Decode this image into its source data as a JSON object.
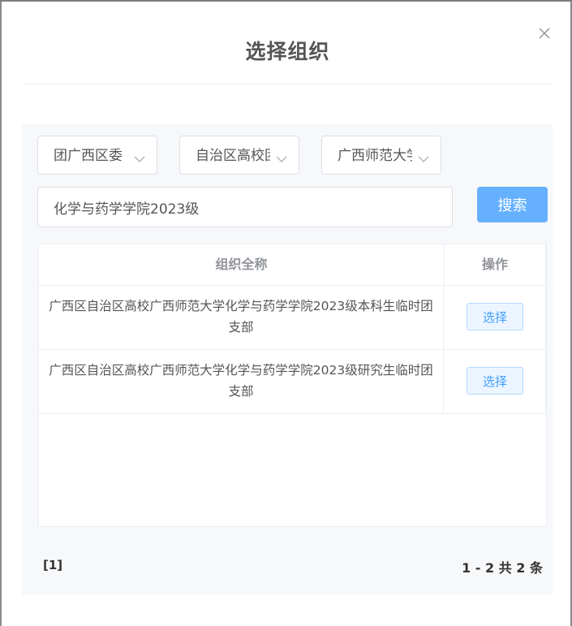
{
  "dialog": {
    "title": "选择组织"
  },
  "filters": {
    "selects": [
      {
        "value": "团广西区委"
      },
      {
        "value": "自治区高校团委"
      },
      {
        "value": "广西师范大学团委"
      }
    ],
    "search_value": "化学与药学学院2023级",
    "search_button_label": "搜索"
  },
  "table": {
    "columns": [
      "组织全称",
      "操作"
    ],
    "rows": [
      {
        "name": "广西区自治区高校广西师范大学化学与药学学院2023级本科生临时团支部",
        "action_label": "选择"
      },
      {
        "name": "广西区自治区高校广西师范大学化学与药学学院2023级研究生临时团支部",
        "action_label": "选择"
      }
    ]
  },
  "pagination": {
    "pages": "[1]",
    "summary": "1 - 2  共 2 条"
  },
  "icons": {
    "close": "close-icon",
    "select_arrow": "chevron-down-icon"
  },
  "colors": {
    "primary_button": "#66b1ff",
    "link_blue": "#409eff",
    "panel_bg": "#f7f8fa"
  }
}
